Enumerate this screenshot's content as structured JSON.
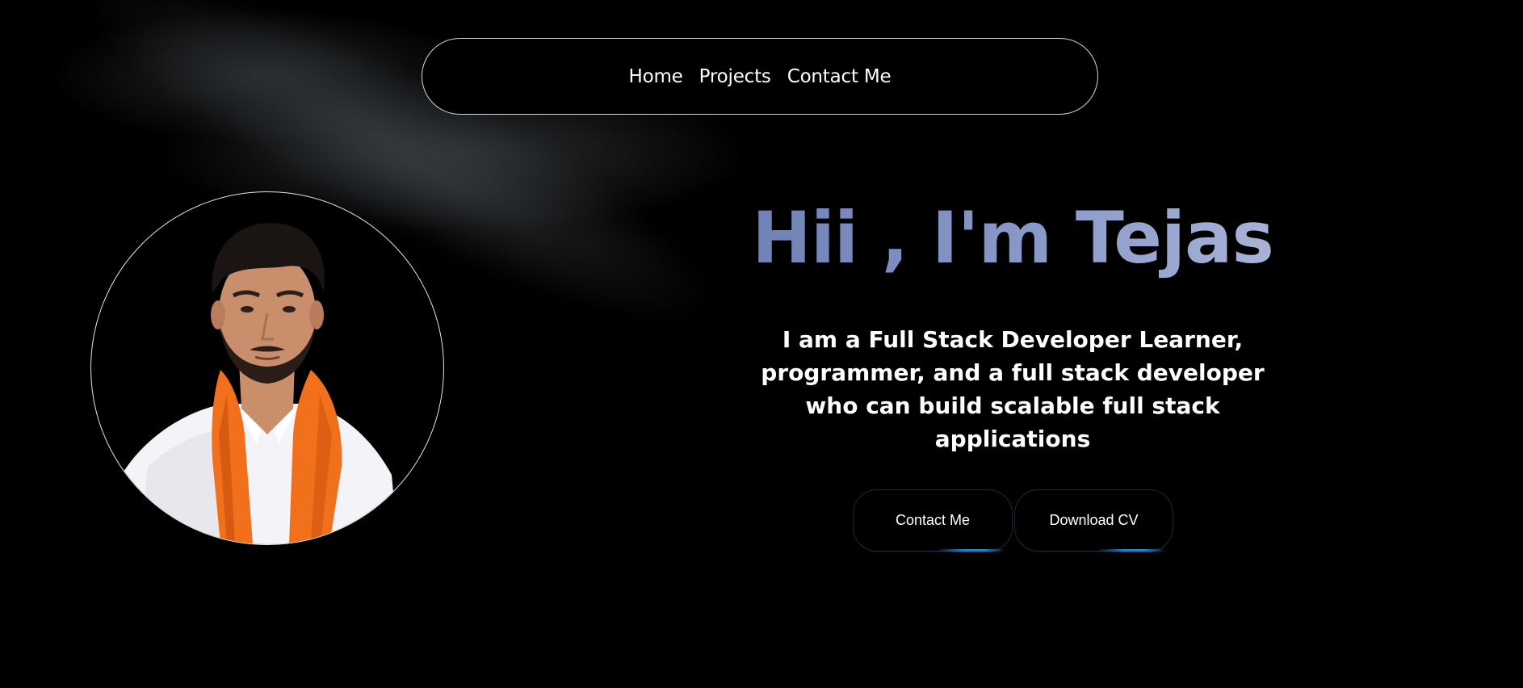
{
  "nav": {
    "items": [
      {
        "label": "Home"
      },
      {
        "label": "Projects"
      },
      {
        "label": "Contact Me"
      }
    ]
  },
  "hero": {
    "title": "Hii , I'm Tejas",
    "description": "I am a Full Stack Developer Learner, programmer, and a full stack developer who can build scalable full stack applications",
    "buttons": {
      "contact": "Contact Me",
      "download_cv": "Download CV"
    }
  },
  "colors": {
    "background": "#000000",
    "title_gradient_start": "#6d80b6",
    "title_gradient_end": "#aab5d9",
    "button_accent": "#1a8ad0",
    "scarf": "#f2701c",
    "shirt": "#f4f3f7"
  }
}
